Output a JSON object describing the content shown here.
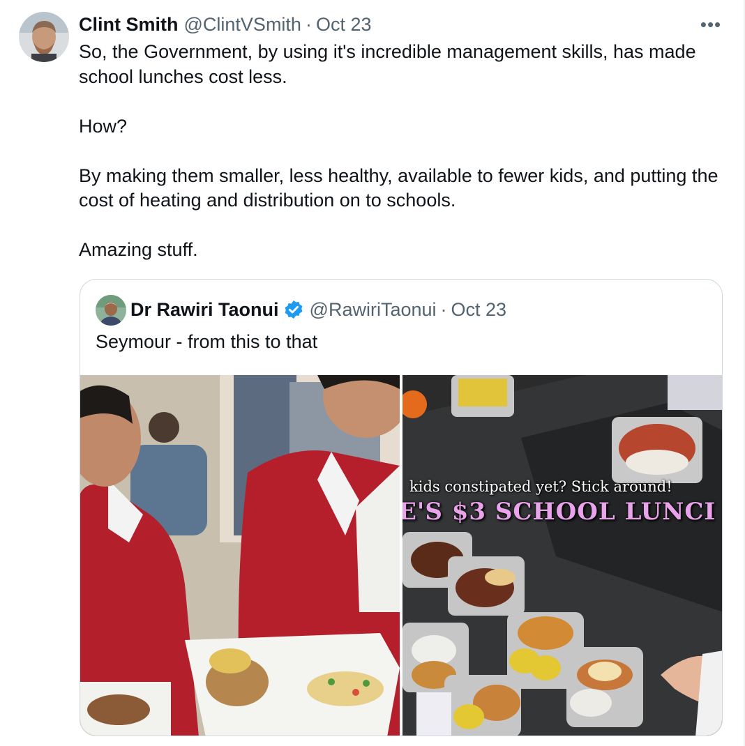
{
  "tweet": {
    "author": {
      "name": "Clint Smith",
      "handle": "@ClintVSmith",
      "separator": "·",
      "date": "Oct 23"
    },
    "more_label": "•••",
    "paragraphs": [
      "So, the Government, by using it's incredible management skills, has made school lunches cost less.",
      "How?",
      "By making them smaller, less healthy, available to fewer kids, and putting the cost of heating and distribution on to schools.",
      "Amazing stuff."
    ]
  },
  "quoted_tweet": {
    "author": {
      "name": "Dr Rawiri Taonui",
      "handle": "@RawiriTaonui",
      "separator": "·",
      "date": "Oct 23",
      "verified": true
    },
    "text": "Seymour - from this to that",
    "images": [
      {
        "icon": "photo-students-lunch"
      },
      {
        "icon": "photo-school-lunch-trays",
        "overlay_line1": "kids constipated yet? Stick around!",
        "overlay_line2": "E'S $3 SCHOOL LUNCI"
      }
    ]
  },
  "colors": {
    "text_primary": "#0f1419",
    "text_secondary": "#536471",
    "border": "#cfd9de",
    "verified_blue": "#1d9bf0",
    "overlay_pink": "#e9a3ea"
  }
}
